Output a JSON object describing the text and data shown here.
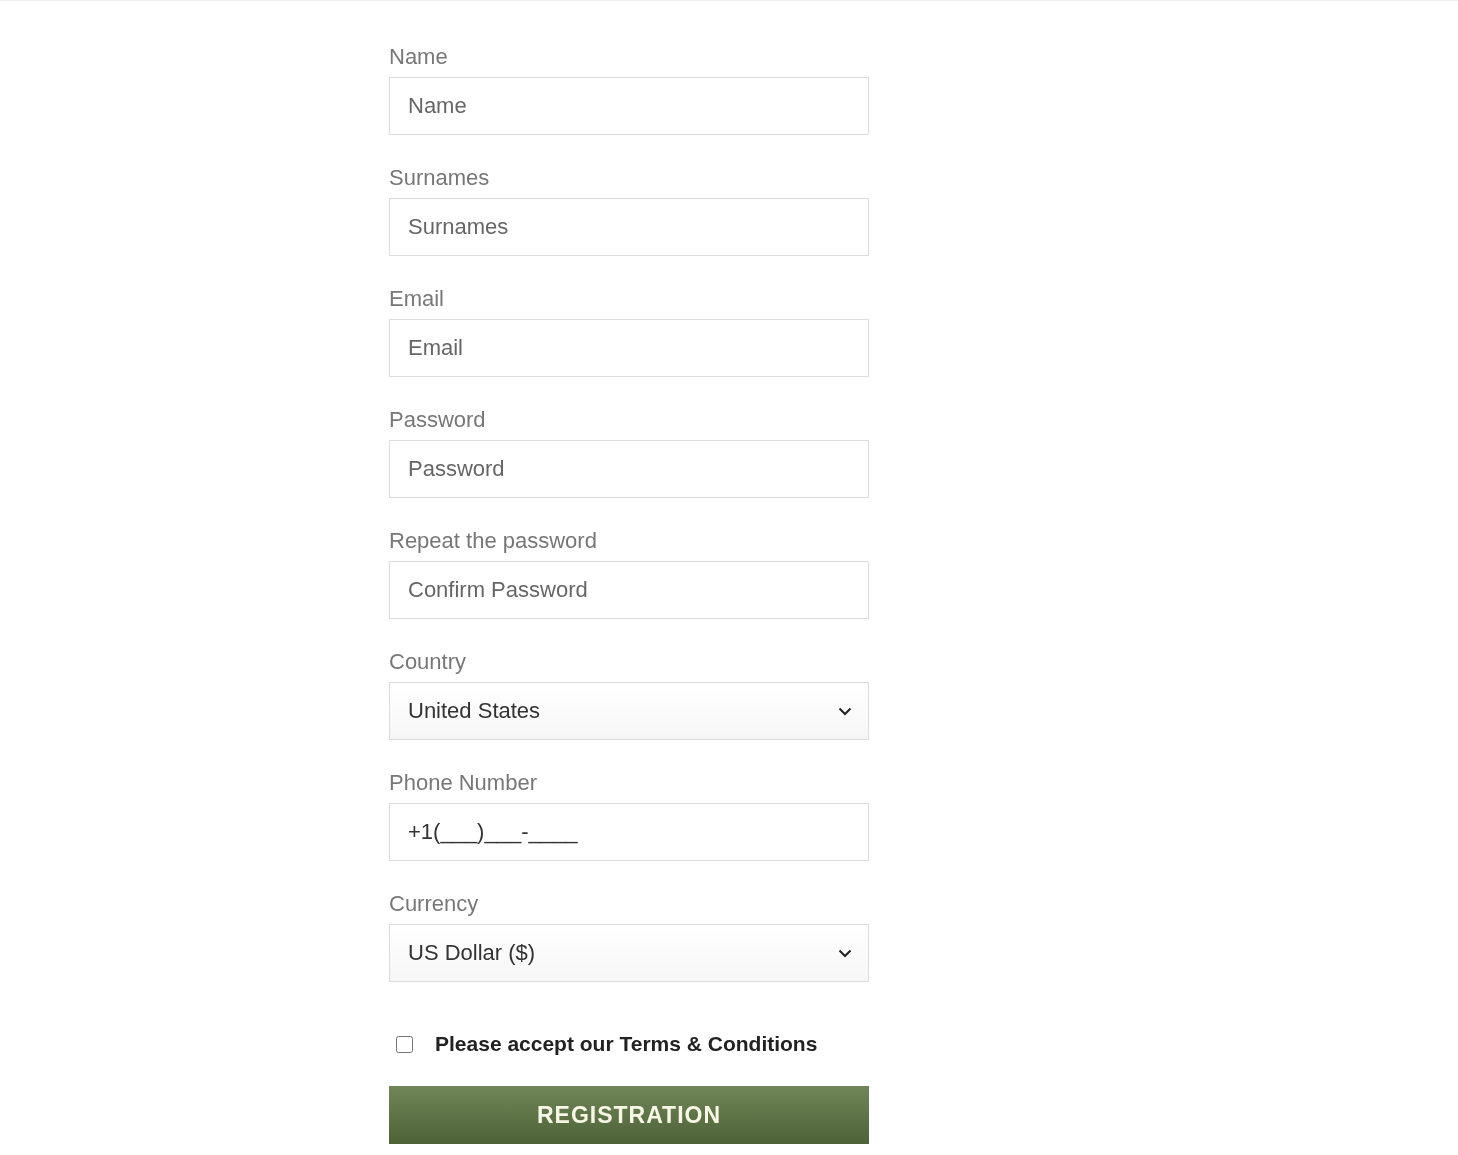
{
  "fields": [
    {
      "label": "Name",
      "kind": "text",
      "placeholder": "Name"
    },
    {
      "label": "Surnames",
      "kind": "text",
      "placeholder": "Surnames"
    },
    {
      "label": "Email",
      "kind": "text",
      "placeholder": "Email"
    },
    {
      "label": "Password",
      "kind": "text",
      "placeholder": "Password"
    },
    {
      "label": "Repeat the password",
      "kind": "text",
      "placeholder": "Confirm Password"
    },
    {
      "label": "Country",
      "kind": "select",
      "value": "United States"
    },
    {
      "label": "Phone Number",
      "kind": "masked",
      "value": "+1(___)___-____"
    },
    {
      "label": "Currency",
      "kind": "select",
      "value": "US Dollar ($)"
    }
  ],
  "terms": {
    "label": "Please accept our Terms & Conditions",
    "checked": false
  },
  "submit": {
    "label": "REGISTRATION"
  }
}
